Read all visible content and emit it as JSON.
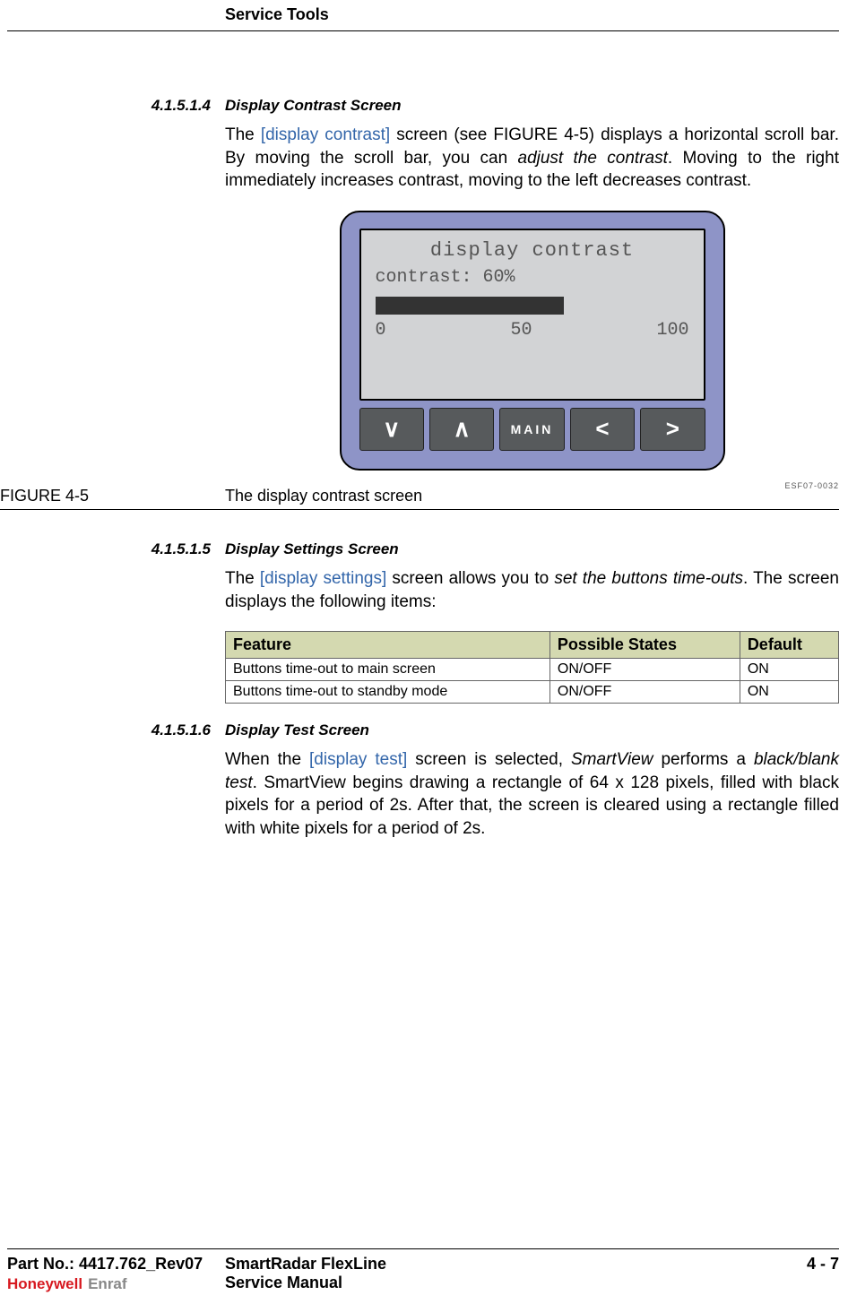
{
  "header": {
    "title": "Service Tools"
  },
  "sections": {
    "s1": {
      "num": "4.1.5.1.4",
      "title": "Display Contrast Screen",
      "para_pre": "The ",
      "link": "[display contrast]",
      "para_mid1": " screen (see FIGURE 4-5) displays a horizontal scroll bar. By moving the scroll bar, you can ",
      "italic": "adjust the contrast",
      "para_post": ". Moving to the right immediately increases contrast, moving to the left decreases contrast."
    },
    "s2": {
      "num": "4.1.5.1.5",
      "title": "Display Settings Screen",
      "para_pre": "The ",
      "link": "[display settings]",
      "para_mid1": " screen allows you to ",
      "italic": "set the buttons time-outs",
      "para_post": ". The screen displays the following items:"
    },
    "s3": {
      "num": "4.1.5.1.6",
      "title": "Display Test Screen",
      "para_pre": "When the ",
      "link": "[display test]",
      "para_mid1": " screen is selected, ",
      "italic1": "SmartView",
      "para_mid2": " performs a ",
      "italic2": "black/blank test",
      "para_post": ". SmartView begins drawing a rectangle of 64 x 128 pixels, filled with black pixels for a period of 2s. After that, the screen is cleared using a rectangle filled with white pixels for a period of 2s."
    }
  },
  "device": {
    "lcd_title": "display contrast",
    "contrast_label": "contrast:",
    "contrast_value": "60%",
    "scale_min": "0",
    "scale_mid": "50",
    "scale_max": "100",
    "buttons": {
      "down": "∨",
      "up": "∧",
      "main": "MAIN",
      "left": "<",
      "right": ">"
    }
  },
  "figure": {
    "ref_code": "ESF07-0032",
    "num": "FIGURE  4-5",
    "caption": "The display contrast screen"
  },
  "table": {
    "headers": {
      "c1": "Feature",
      "c2": "Possible States",
      "c3": "Default"
    },
    "rows": [
      {
        "c1": "Buttons time-out to main screen",
        "c2": "ON/OFF",
        "c3": "ON"
      },
      {
        "c1": "Buttons time-out to standby mode",
        "c2": "ON/OFF",
        "c3": "ON"
      }
    ]
  },
  "footer": {
    "part_no": "Part No.: 4417.762_Rev07",
    "product": "SmartRadar FlexLine",
    "manual": "Service Manual",
    "page": "4 - 7",
    "logo_hw": "Honeywell",
    "logo_enraf": "Enraf"
  }
}
